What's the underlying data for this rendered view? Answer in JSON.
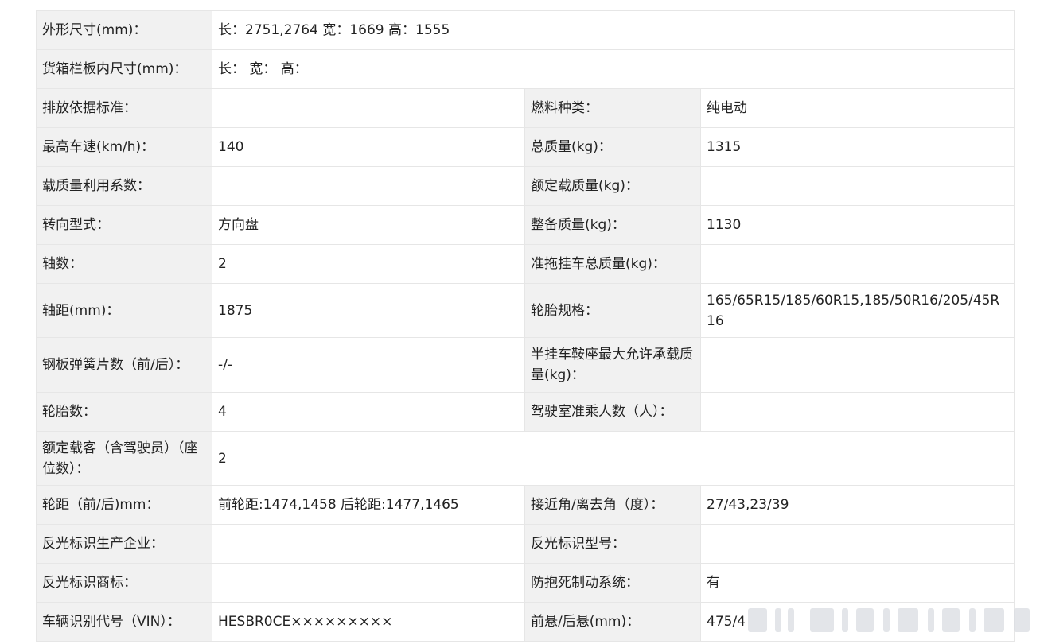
{
  "spec_table": {
    "rows": [
      {
        "cells": [
          {
            "label": "外形尺寸(mm)：",
            "value": "长：2751,2764 宽：1669 高：1555"
          }
        ]
      },
      {
        "cells": [
          {
            "label": "货箱栏板内尺寸(mm)：",
            "value": "长： 宽： 高："
          }
        ]
      },
      {
        "cells": [
          {
            "label": "排放依据标准：",
            "value": ""
          },
          {
            "label": "燃料种类：",
            "value": "纯电动"
          }
        ]
      },
      {
        "cells": [
          {
            "label": "最高车速(km/h)：",
            "value": "140"
          },
          {
            "label": "总质量(kg)：",
            "value": "1315"
          }
        ]
      },
      {
        "cells": [
          {
            "label": "载质量利用系数：",
            "value": ""
          },
          {
            "label": "额定载质量(kg)：",
            "value": ""
          }
        ]
      },
      {
        "cells": [
          {
            "label": "转向型式：",
            "value": "方向盘"
          },
          {
            "label": "整备质量(kg)：",
            "value": "1130"
          }
        ]
      },
      {
        "cells": [
          {
            "label": "轴数：",
            "value": "2"
          },
          {
            "label": "准拖挂车总质量(kg)：",
            "value": ""
          }
        ]
      },
      {
        "cells": [
          {
            "label": "轴距(mm)：",
            "value": "1875"
          },
          {
            "label": "轮胎规格：",
            "value": "165/65R15/185/60R15,185/50R16/205/45R16"
          }
        ]
      },
      {
        "cells": [
          {
            "label": "钢板弹簧片数（前/后）：",
            "value": "-/-"
          },
          {
            "label": "半挂车鞍座最大允许承载质量(kg)：",
            "value": ""
          }
        ]
      },
      {
        "cells": [
          {
            "label": "轮胎数：",
            "value": "4"
          },
          {
            "label": "驾驶室准乘人数（人）：",
            "value": ""
          }
        ]
      },
      {
        "cells": [
          {
            "label": "额定载客（含驾驶员）（座位数）：",
            "value": "2"
          }
        ]
      },
      {
        "cells": [
          {
            "label": "轮距（前/后)mm：",
            "value": "前轮距:1474,1458 后轮距:1477,1465"
          },
          {
            "label": "接近角/离去角（度）：",
            "value": "27/43,23/39"
          }
        ]
      },
      {
        "cells": [
          {
            "label": "反光标识生产企业：",
            "value": ""
          },
          {
            "label": "反光标识型号：",
            "value": ""
          }
        ]
      },
      {
        "cells": [
          {
            "label": "反光标识商标：",
            "value": ""
          },
          {
            "label": "防抱死制动系统：",
            "value": "有"
          }
        ]
      },
      {
        "cells": [
          {
            "label": "车辆识别代号（VIN）：",
            "value": "HESBR0CE×××××××××"
          },
          {
            "label": "前悬/后悬(mm)：",
            "value": "475/4"
          }
        ]
      }
    ]
  }
}
